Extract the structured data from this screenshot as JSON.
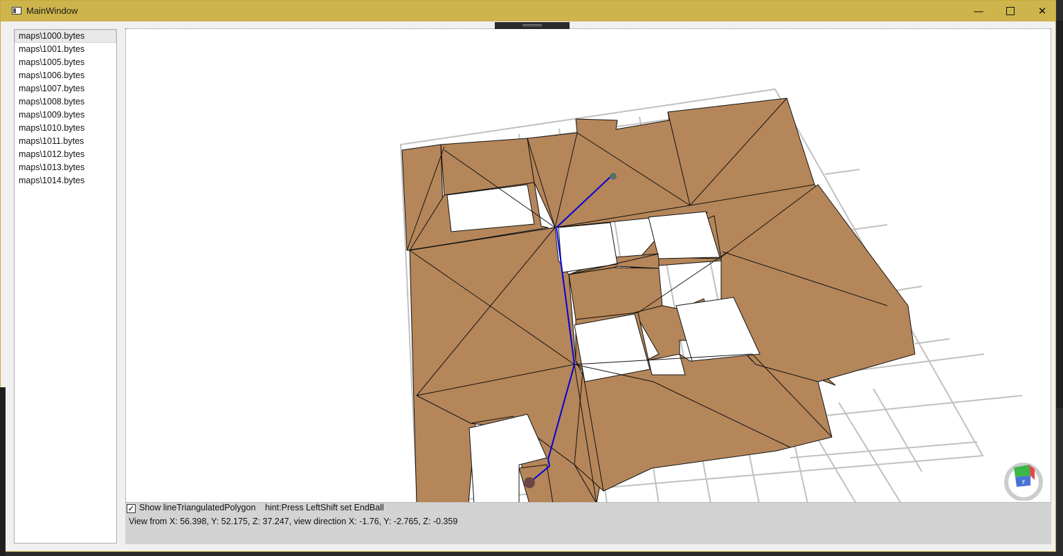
{
  "window": {
    "title": "MainWindow",
    "min_icon": "minimize-icon",
    "max_icon": "maximize-icon",
    "close_icon": "close-icon",
    "accent_color": "#cdb44c"
  },
  "file_list": {
    "selected_index": 0,
    "items": [
      "maps\\1000.bytes",
      "maps\\1001.bytes",
      "maps\\1005.bytes",
      "maps\\1006.bytes",
      "maps\\1007.bytes",
      "maps\\1008.bytes",
      "maps\\1009.bytes",
      "maps\\1010.bytes",
      "maps\\1011.bytes",
      "maps\\1012.bytes",
      "maps\\1013.bytes",
      "maps\\1014.bytes"
    ]
  },
  "viewport": {
    "mesh_color": "#b5865a",
    "path_color": "#0000dd",
    "grid_color": "#bbbbbb",
    "gizmo_icon": "axis-cube-icon"
  },
  "bottom": {
    "checkbox_checked": true,
    "checkbox_label": "Show lineTriangulatedPolygon",
    "hint": "hint:Press LeftShift set EndBall",
    "status": "View from X: 56.398, Y: 52.175, Z: 37.247, view direction X: -1.76, Y: -2.765, Z: -0.359"
  }
}
